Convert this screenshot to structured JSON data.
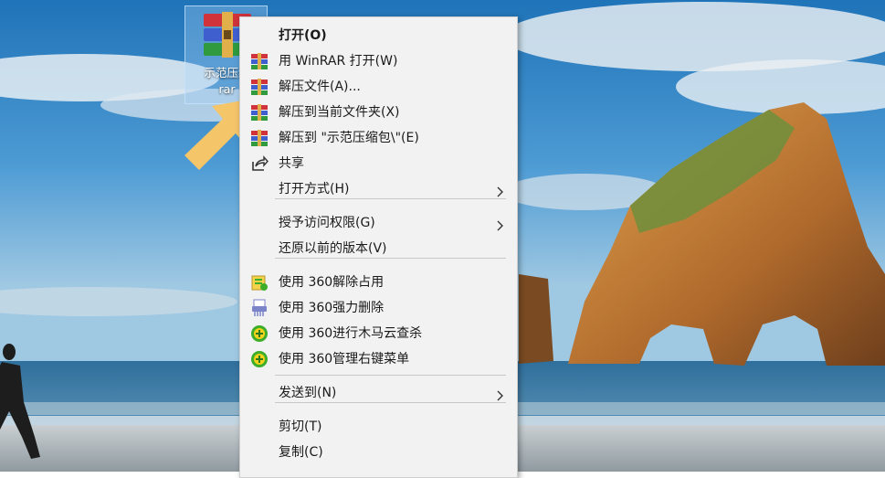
{
  "desktop": {
    "file_icon": {
      "name": "winrar-archive-icon",
      "label_line1": "示范压缩",
      "label_line2": "rar"
    },
    "pointer_arrow_color": "#f5c56a"
  },
  "context_menu": {
    "items": [
      {
        "label": "打开(O)",
        "icon": "none",
        "bold": true
      },
      {
        "label": "用 WinRAR 打开(W)",
        "icon": "winrar-icon"
      },
      {
        "label": "解压文件(A)...",
        "icon": "winrar-icon"
      },
      {
        "label": "解压到当前文件夹(X)",
        "icon": "winrar-icon"
      },
      {
        "label": "解压到 \"示范压缩包\\\"(E)",
        "icon": "winrar-icon"
      },
      {
        "label": "共享",
        "icon": "share-icon"
      },
      {
        "label": "打开方式(H)",
        "icon": "none",
        "submenu": true
      },
      {
        "label": "授予访问权限(G)",
        "icon": "none",
        "submenu": true
      },
      {
        "label": "还原以前的版本(V)",
        "icon": "none"
      },
      {
        "label": "使用 360解除占用",
        "icon": "360-unlock-icon"
      },
      {
        "label": "使用 360强力删除",
        "icon": "360-shredder-icon"
      },
      {
        "label": "使用 360进行木马云查杀",
        "icon": "360-scan-icon"
      },
      {
        "label": "使用 360管理右键菜单",
        "icon": "360-menu-manager-icon"
      },
      {
        "label": "发送到(N)",
        "icon": "none",
        "submenu": true
      },
      {
        "label": "剪切(T)",
        "icon": "none"
      },
      {
        "label": "复制(C)",
        "icon": "none"
      }
    ]
  },
  "colors": {
    "menu_background": "#f2f2f2",
    "menu_separator": "#c8c8c8",
    "menu_text": "#1a1a1a",
    "360_green": "#3cae2a",
    "360_yellow": "#f2d21a"
  }
}
